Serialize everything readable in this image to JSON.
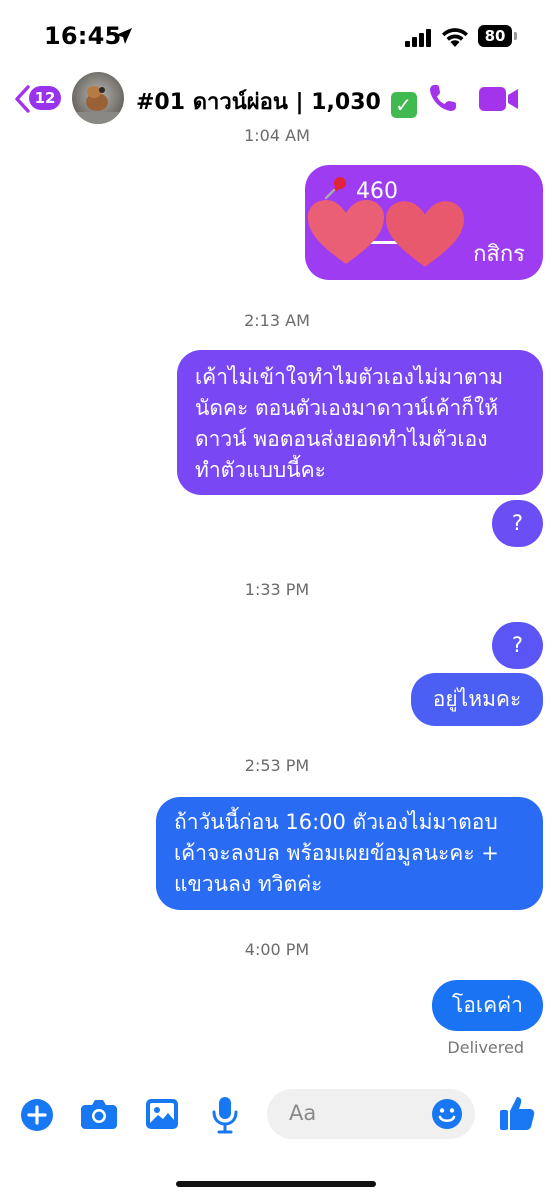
{
  "status_bar": {
    "time": "16:45",
    "battery": "80"
  },
  "header": {
    "unread_count": "12",
    "title": "#01 ดาวน์ผ่อน | 1,030",
    "check_icon": "✓"
  },
  "messages": {
    "ts1": "1:04 AM",
    "pinned_text": "460",
    "pinned_bank": "กสิกร",
    "ts2": "2:13 AM",
    "msg1_line1": "เค้าไม่เข้าใจทำไมตัวเองไม่มาตาม",
    "msg1_line2": "นัดคะ ตอนตัวเองมาดาวน์เค้าก็ให้",
    "msg1_line3": "ดาวน์ พอตอนส่งยอดทำไมตัวเอง",
    "msg1_line4": "ทำตัวแบบนี้คะ",
    "q1": "?",
    "ts3": "1:33 PM",
    "q2": "?",
    "msg2": "อยู่ไหมคะ",
    "ts4": "2:53 PM",
    "msg3_line1": "ถ้าวันนี้ก่อน 16:00 ตัวเองไม่มาตอบ",
    "msg3_line2": "เค้าจะลงบล พร้อมเผยข้อมูลนะคะ +",
    "msg3_line3": "แขวนลง ทวิตค่ะ",
    "ts5": "4:00 PM",
    "msg4": "โอเคค่า",
    "delivered": "Delivered"
  },
  "composer": {
    "placeholder": "Aa"
  },
  "colors": {
    "purple_top": "#9b3bf0",
    "purple_mid": "#7a4cf5",
    "blue_bottom": "#1a73f2",
    "accent_blue": "#1877f2",
    "header_accent": "#a334ec"
  },
  "icons": [
    "location-arrow-icon",
    "signal-icon",
    "wifi-icon",
    "back-chevron-icon",
    "phone-icon",
    "video-icon",
    "plus-icon",
    "camera-icon",
    "image-icon",
    "microphone-icon",
    "emoji-icon",
    "thumbs-up-icon",
    "pin-icon",
    "heart-sticker-icon"
  ]
}
